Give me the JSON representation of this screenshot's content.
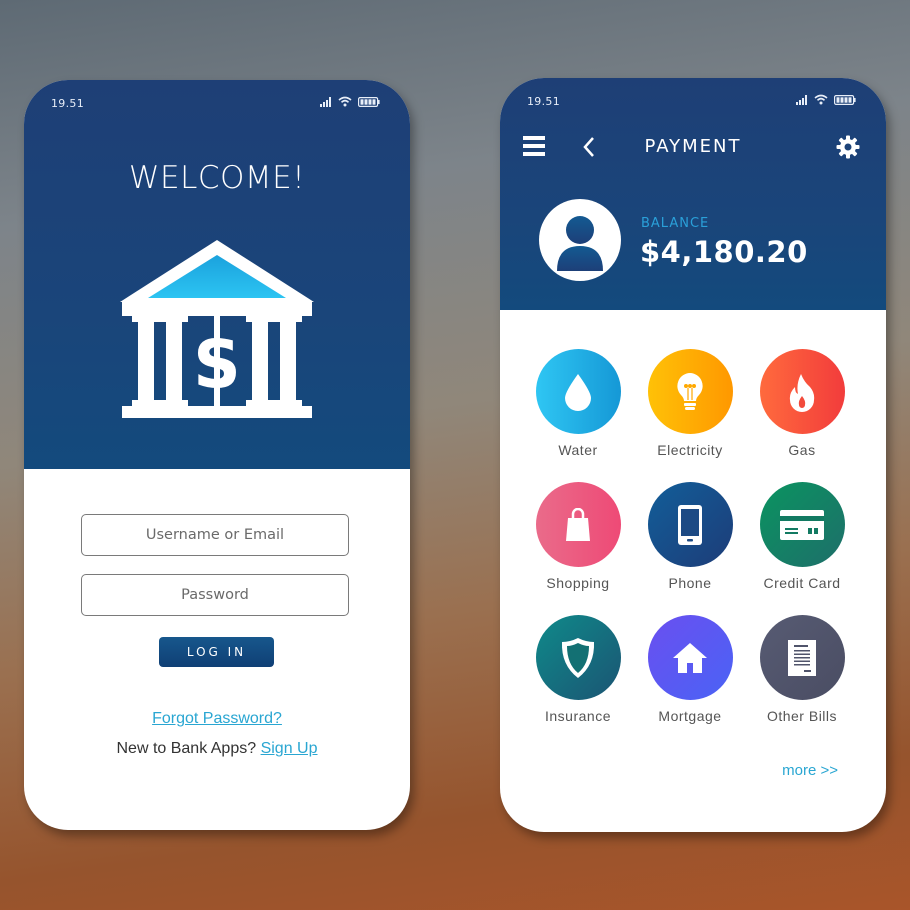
{
  "login_screen": {
    "status_time": "19.51",
    "title": "WELCOME!",
    "username_placeholder": "Username or Email",
    "password_placeholder": "Password",
    "login_button": "LOG IN",
    "forgot_password": "Forgot Password?",
    "signup_prompt": "New to Bank Apps?",
    "signup_link": "Sign Up"
  },
  "payment_screen": {
    "status_time": "19.51",
    "title": "PAYMENT",
    "balance_label": "BALANCE",
    "balance_value": "$4,180.20",
    "more_link": "more >>",
    "categories": [
      {
        "label": "Water",
        "icon": "water-drop-icon",
        "color_from": "#2fc6f3",
        "color_to": "#1598d6"
      },
      {
        "label": "Electricity",
        "icon": "lightbulb-icon",
        "color_from": "#ffc107",
        "color_to": "#ff9800"
      },
      {
        "label": "Gas",
        "icon": "flame-icon",
        "color_from": "#ff6a3d",
        "color_to": "#f23c3c"
      },
      {
        "label": "Shopping",
        "icon": "shopping-bag-icon",
        "color_from": "#ea6b8a",
        "color_to": "#ee4a76"
      },
      {
        "label": "Phone",
        "icon": "smartphone-icon",
        "color_from": "#125e99",
        "color_to": "#1d3c78"
      },
      {
        "label": "Credit Card",
        "icon": "credit-card-icon",
        "color_from": "#0a9460",
        "color_to": "#1e6e6a"
      },
      {
        "label": "Insurance",
        "icon": "shield-icon",
        "color_from": "#0f8a8a",
        "color_to": "#1b5473"
      },
      {
        "label": "Mortgage",
        "icon": "house-icon",
        "color_from": "#6a4ff0",
        "color_to": "#4a63f5"
      },
      {
        "label": "Other Bills",
        "icon": "document-icon",
        "color_from": "#575b73",
        "color_to": "#4a4d63"
      }
    ]
  },
  "colors": {
    "primary_blue": "#1b4277",
    "accent_cyan": "#29a6d2"
  }
}
